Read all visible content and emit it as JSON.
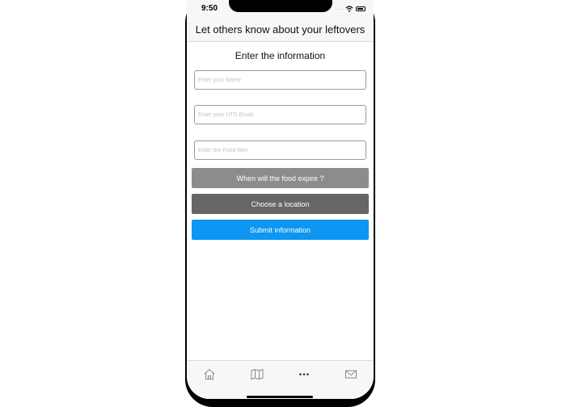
{
  "status_bar": {
    "time": "9:50",
    "signal": "...."
  },
  "nav": {
    "title": "Let others know about your leftovers"
  },
  "form": {
    "heading": "Enter the information",
    "name_placeholder": "Enter your Name",
    "email_placeholder": "Enter your UTD Email",
    "food_placeholder": "Enter the Food Item",
    "expire_label": "When will the food expire ?",
    "location_label": "Choose a location",
    "submit_label": "Submit information"
  },
  "tabs": [
    {
      "icon": "home-icon"
    },
    {
      "icon": "map-icon"
    },
    {
      "icon": "more-icon"
    },
    {
      "icon": "mail-icon"
    }
  ],
  "colors": {
    "expire_button": "#8c8c8c",
    "location_button": "#666666",
    "submit_button": "#0d96f2"
  }
}
